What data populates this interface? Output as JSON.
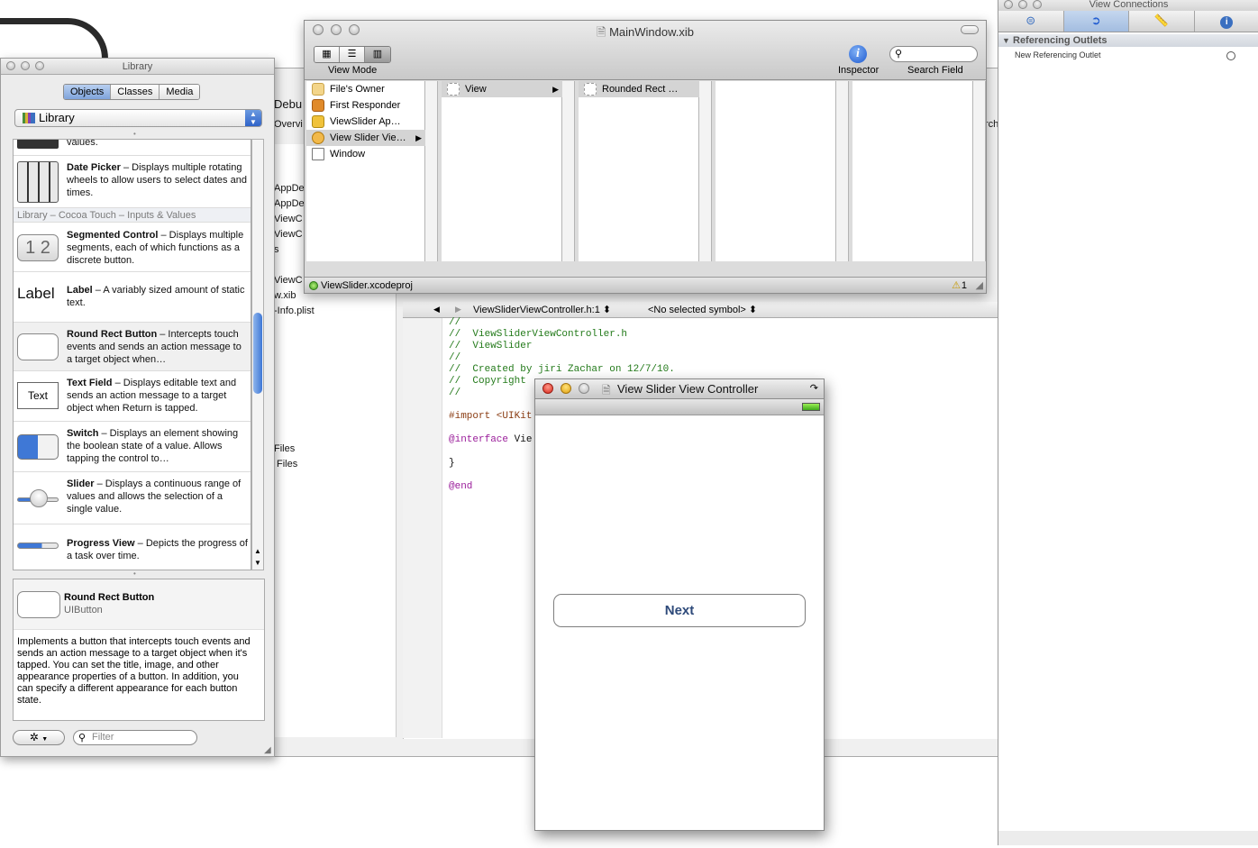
{
  "library": {
    "title": "Library",
    "tabs": [
      "Objects",
      "Classes",
      "Media"
    ],
    "active_tab": "Objects",
    "popup_value": "Library",
    "partial_item_text": "values.",
    "section_header": "Library – Cocoa Touch – Inputs & Values",
    "items": [
      {
        "name": "Date Picker",
        "desc": " – Displays multiple rotating wheels to allow users to select dates and times."
      },
      {
        "name": "Segmented Control",
        "desc": " – Displays multiple segments, each of which functions as a discrete button."
      },
      {
        "name": "Label",
        "desc": " – A variably sized amount of static text."
      },
      {
        "name": "Round Rect Button",
        "desc": " – Intercepts touch events and sends an action message to a target object when…"
      },
      {
        "name": "Text Field",
        "desc": " – Displays editable text and sends an action message to a target object when Return is tapped."
      },
      {
        "name": "Switch",
        "desc": " – Displays an element showing the boolean state of a value. Allows tapping the control to…"
      },
      {
        "name": "Slider",
        "desc": " – Displays a continuous range of values and allows the selection of a single value."
      },
      {
        "name": "Progress View",
        "desc": " – Depicts the progress of a task over time."
      }
    ],
    "icon_labels": {
      "segmented": "1  2",
      "label": "Label",
      "textfield": "Text"
    },
    "detail": {
      "title": "Round Rect Button",
      "class": "UIButton",
      "description": "Implements a button that intercepts touch events and sends an action message to a target object when it's tapped. You can set the title, image, and other appearance properties of a button. In addition, you can specify a different appearance for each button state."
    },
    "filter_placeholder": "Filter"
  },
  "xib": {
    "title": "MainWindow.xib",
    "view_mode_label": "View Mode",
    "inspector_label": "Inspector",
    "search_label": "Search Field",
    "column1": [
      "File's Owner",
      "First Responder",
      "ViewSlider Ap…",
      "View Slider Vie…",
      "Window"
    ],
    "column2": [
      "View"
    ],
    "column3": [
      "Rounded Rect …"
    ],
    "status_project": "ViewSlider.xcodeproj",
    "warning_count": "1"
  },
  "xcode_bg": {
    "fragments": [
      "Debu",
      "Overvi",
      "AppDe",
      "AppDe",
      "ViewC",
      "ViewC",
      "s",
      "ViewC",
      "w.xib",
      "-Info.plist",
      "Files",
      "Files",
      "rch"
    ],
    "editor_file": "ViewSliderViewController.h:1 ⬍",
    "editor_symbol": "<No selected symbol> ⬍",
    "code": {
      "l1": "//",
      "l2": "//  ViewSliderViewController.h",
      "l3": "//  ViewSlider",
      "l4": "//",
      "l5": "//  Created by jiri Zachar on 12/7/10.",
      "l6": "//  Copyright",
      "l7": "//",
      "l8": "#import <UIKit",
      "l9a": "@interface",
      "l9b": " Vie",
      "l10": "}",
      "l11": "@end"
    }
  },
  "vsvc": {
    "title": "View Slider View Controller",
    "button_label": "Next"
  },
  "inspector": {
    "title": "View Connections",
    "section": "Referencing Outlets",
    "row": "New Referencing Outlet"
  }
}
